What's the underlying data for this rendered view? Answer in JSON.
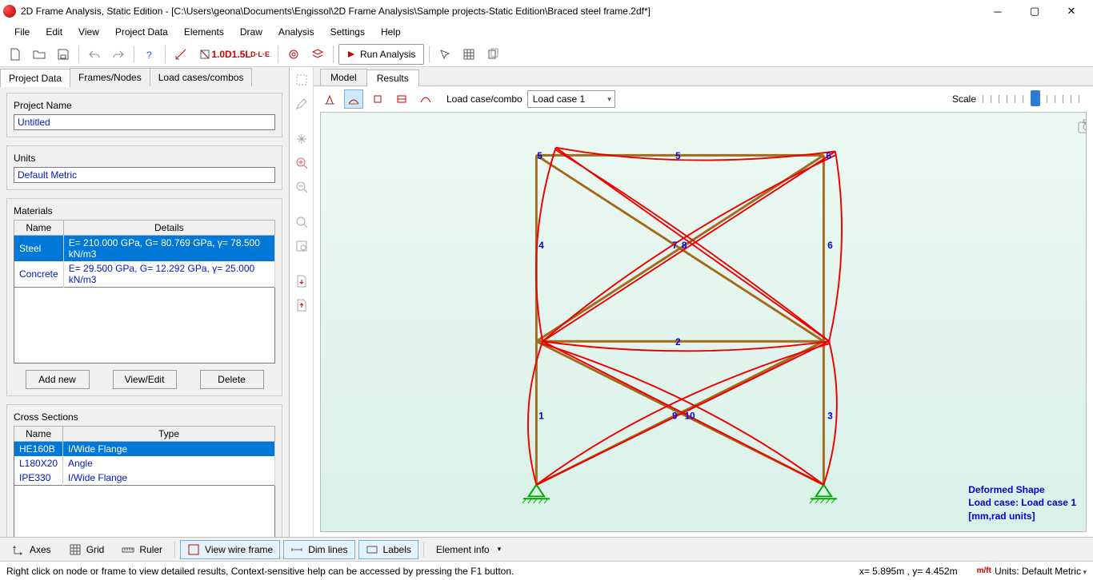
{
  "title": "2D Frame Analysis, Static Edition - [C:\\Users\\geona\\Documents\\Engissol\\2D Frame Analysis\\Sample projects-Static Edition\\Braced steel frame.2df*]",
  "menu": [
    "File",
    "Edit",
    "View",
    "Project Data",
    "Elements",
    "Draw",
    "Analysis",
    "Settings",
    "Help"
  ],
  "toolbar": {
    "run": "Run Analysis",
    "dl": "D·L·E",
    "osd": "1.0D",
    "osl": "1.5L"
  },
  "left_tabs": [
    "Project Data",
    "Frames/Nodes",
    "Load cases/combos"
  ],
  "project": {
    "name_label": "Project Name",
    "name_value": "Untitled",
    "units_label": "Units",
    "units_value": "Default Metric",
    "materials_label": "Materials",
    "materials_headers": [
      "Name",
      "Details"
    ],
    "materials": [
      {
        "name": "Steel",
        "details": "E= 210.000 GPa, G= 80.769 GPa, γ= 78.500 kN/m3"
      },
      {
        "name": "Concrete",
        "details": "E= 29.500 GPa, G= 12.292 GPa, γ= 25.000 kN/m3"
      }
    ],
    "sections_label": "Cross Sections",
    "sections_headers": [
      "Name",
      "Type"
    ],
    "sections": [
      {
        "name": "HE160B",
        "type": "I/Wide Flange"
      },
      {
        "name": "L180X20",
        "type": "Angle"
      },
      {
        "name": "IPE330",
        "type": "I/Wide Flange"
      }
    ],
    "btn_add": "Add new",
    "btn_view": "View/Edit",
    "btn_del": "Delete"
  },
  "canvas_tabs": [
    "Model",
    "Results"
  ],
  "results_bar": {
    "lc_label": "Load case/combo",
    "lc_value": "Load case 1",
    "scale_label": "Scale"
  },
  "viewport_label": {
    "l1": "Deformed Shape",
    "l2": "Load case: Load case 1",
    "l3": "[mm,rad units]"
  },
  "nodes": {
    "n1": "1",
    "n2": "2",
    "n3": "3",
    "n4": "4",
    "n5": "5",
    "n6": "6",
    "n7": "7",
    "n8": "8",
    "n9": "9",
    "n10": "10"
  },
  "bottom": {
    "axes": "Axes",
    "grid": "Grid",
    "ruler": "Ruler",
    "wireframe": "View wire frame",
    "dim": "Dim lines",
    "labels": "Labels",
    "elinfo": "Element info"
  },
  "status": {
    "hint": "Right click on node or frame to view detailed results, Context-sensitive help can be accessed by pressing the F1 button.",
    "coords": "x= 5.895m , y= 4.452m",
    "units_prefix": "m/ft",
    "units": "Units: Default Metric"
  }
}
